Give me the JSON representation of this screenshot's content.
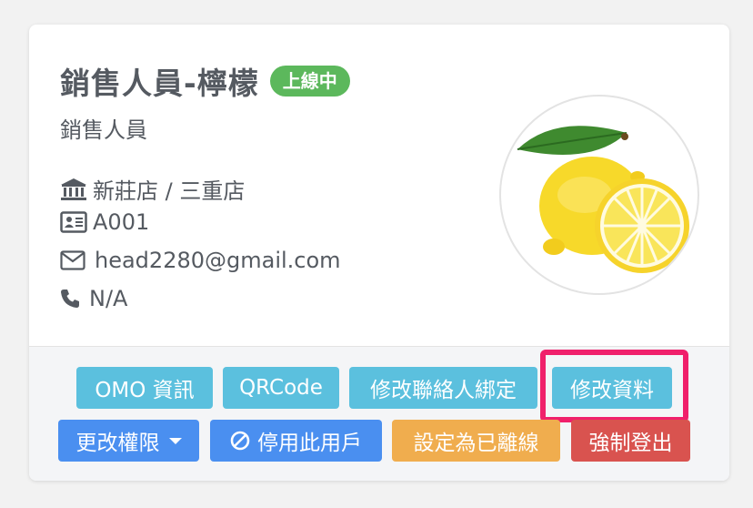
{
  "profile": {
    "name": "銷售人員-檸檬",
    "status_badge": "上線中",
    "role": "銷售人員",
    "store": "新莊店 / 三重店",
    "employee_id": "A001",
    "email": "head2280@gmail.com",
    "phone": "N/A"
  },
  "icons": {
    "store": "bank-icon",
    "id": "id-card-icon",
    "email": "envelope-icon",
    "phone": "phone-icon",
    "disable": "ban-icon",
    "dropdown": "caret-down-icon"
  },
  "actions": {
    "omo_info": "OMO 資訊",
    "qrcode": "QRCode",
    "edit_contact_binding": "修改聯絡人綁定",
    "edit_profile": "修改資料",
    "change_permission": "更改權限",
    "disable_user": "停用此用戶",
    "set_offline": "設定為已離線",
    "force_logout": "強制登出"
  },
  "colors": {
    "online_badge": "#5cb85c",
    "info_button": "#5bc0de",
    "primary_button": "#4a8ff0",
    "warning_button": "#f0ad4e",
    "danger_button": "#d9534f",
    "highlight_box": "#f0206b"
  }
}
